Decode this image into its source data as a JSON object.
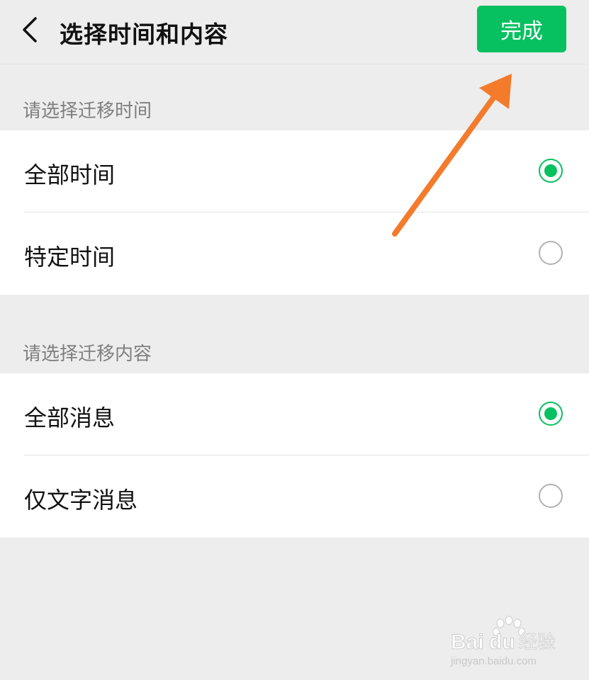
{
  "header": {
    "title": "选择时间和内容",
    "done_label": "完成",
    "accent": "#07c160"
  },
  "time_section": {
    "label": "请选择迁移时间",
    "options": [
      {
        "label": "全部时间",
        "selected": true
      },
      {
        "label": "特定时间",
        "selected": false
      }
    ]
  },
  "content_section": {
    "label": "请选择迁移内容",
    "options": [
      {
        "label": "全部消息",
        "selected": true
      },
      {
        "label": "仅文字消息",
        "selected": false
      }
    ]
  },
  "annotation": {
    "arrow_color": "#f47b2c"
  },
  "watermark": {
    "brand": "Baidu经验",
    "url": "jingyan.baidu.com"
  }
}
